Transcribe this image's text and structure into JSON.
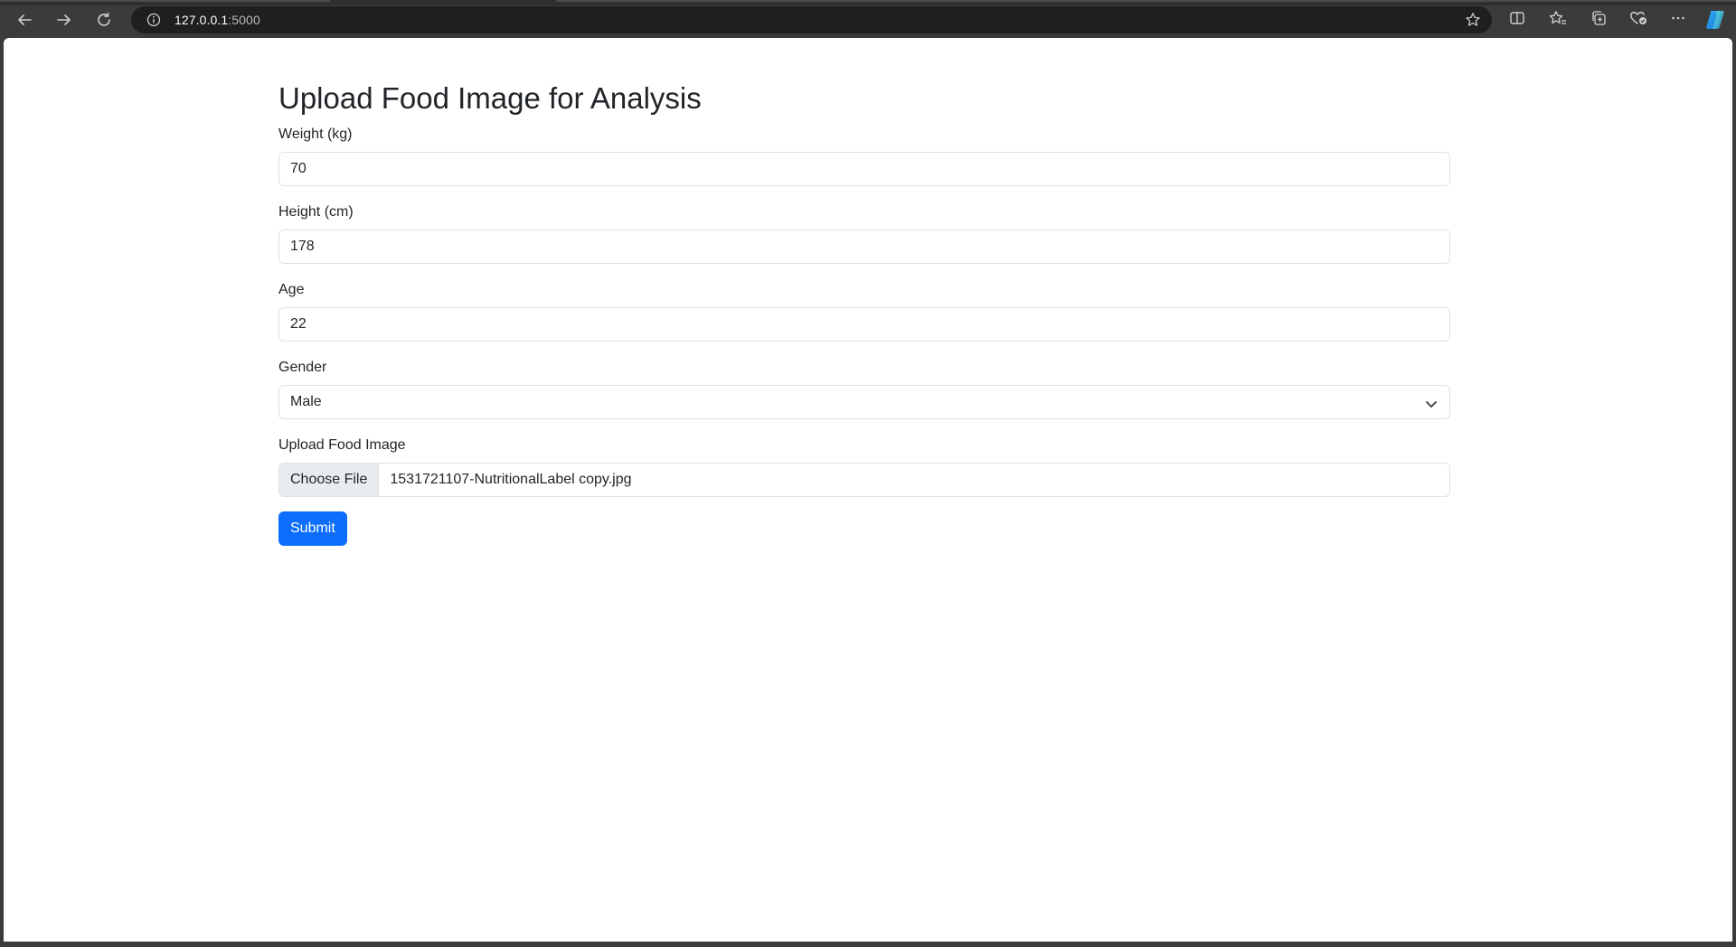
{
  "browser": {
    "url_host": "127.0.0.1",
    "url_port": ":5000",
    "icons": [
      "back-icon",
      "forward-icon",
      "reload-icon",
      "site-info-icon",
      "favorite-star-icon",
      "split-screen-icon",
      "favorites-icon",
      "collections-icon",
      "browser-essentials-icon",
      "more-menu-icon",
      "copilot-icon"
    ]
  },
  "form": {
    "title": "Upload Food Image for Analysis",
    "weight": {
      "label": "Weight (kg)",
      "value": "70"
    },
    "height": {
      "label": "Height (cm)",
      "value": "178"
    },
    "age": {
      "label": "Age",
      "value": "22"
    },
    "gender": {
      "label": "Gender",
      "selected": "Male"
    },
    "image": {
      "label": "Upload Food Image",
      "button": "Choose File",
      "file_name": "1531721107-NutritionalLabel copy.jpg"
    },
    "submit_label": "Submit"
  },
  "colors": {
    "primary": "#0d6efd",
    "text": "#212529",
    "border": "#dee2e6",
    "chrome": "#3b3b3b"
  }
}
